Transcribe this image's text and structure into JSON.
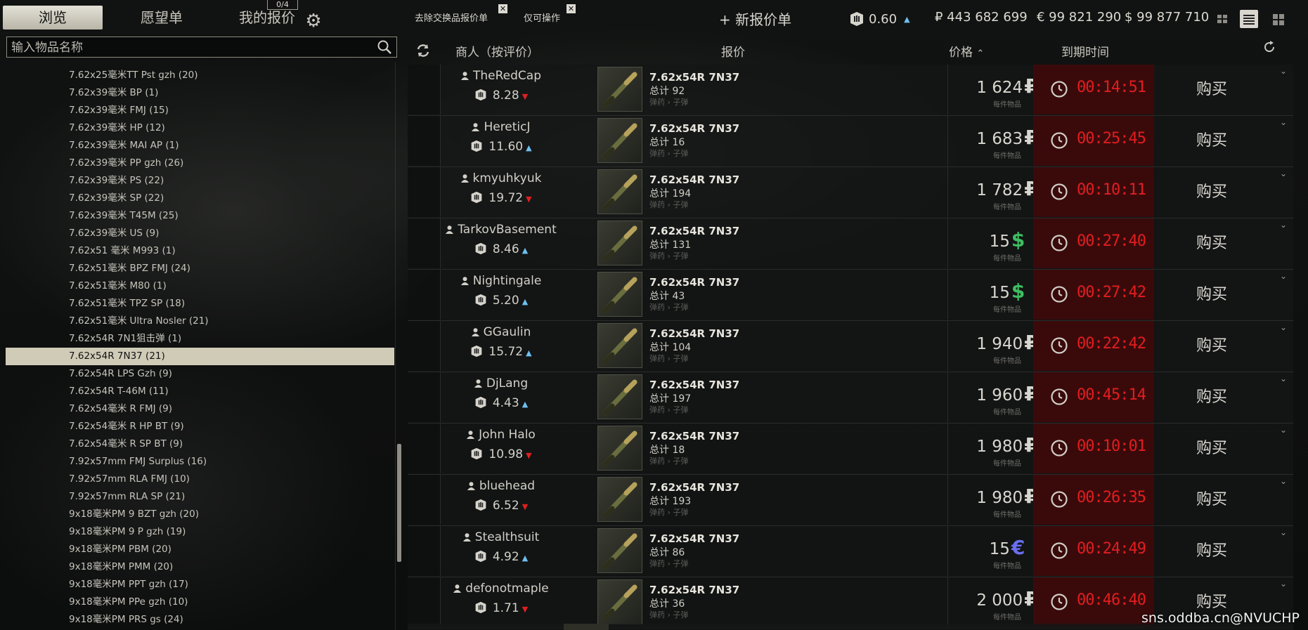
{
  "tabs": [
    {
      "label": "浏览"
    },
    {
      "label": "愿望单"
    },
    {
      "label": "我的报价"
    }
  ],
  "offers_badge": "0/4",
  "search": {
    "placeholder": "输入物品名称"
  },
  "categories": [
    "7.62x25毫米TT Pst gzh (20)",
    "7.62x39毫米 BP (1)",
    "7.62x39毫米 FMJ (15)",
    "7.62x39毫米 HP (12)",
    "7.62x39毫米 MAI AP (1)",
    "7.62x39毫米 PP gzh (26)",
    "7.62x39毫米 PS (22)",
    "7.62x39毫米 SP (22)",
    "7.62x39毫米 T45M (25)",
    "7.62x39毫米 US (9)",
    "7.62x51 毫米 M993 (1)",
    "7.62x51毫米 BPZ FMJ (24)",
    "7.62x51毫米 M80 (1)",
    "7.62x51毫米 TPZ SP (18)",
    "7.62x51毫米 Ultra Nosler (21)",
    "7.62x54R 7N1狙击弹 (1)",
    "7.62x54R 7N37 (21)",
    "7.62x54R LPS Gzh (9)",
    "7.62x54R T-46M (11)",
    "7.62x54毫米 R FMJ (9)",
    "7.62x54毫米 R HP BT (9)",
    "7.62x54毫米 R SP BT (9)",
    "7.92x57mm FMJ Surplus (16)",
    "7.92x57mm RLA FMJ (10)",
    "7.92x57mm RLA SP (21)",
    "9x18毫米PM 9 BZT gzh (20)",
    "9x18毫米PM 9 P gzh (19)",
    "9x18毫米PM PBM (20)",
    "9x18毫米PM PMM (20)",
    "9x18毫米PM PPT gzh (17)",
    "9x18毫米PM PPe gzh (10)",
    "9x18毫米PM PRS gs (24)"
  ],
  "selected_category_index": 16,
  "filters": {
    "remove_barter": "去除交换品报价单",
    "operable_only": "仅可操作"
  },
  "new_offer": "+ 新报价单",
  "player_rating": {
    "value": "0.60",
    "trend": "▲"
  },
  "currencies": {
    "rub": "₽ 443 682 699",
    "eur": "€ 99 821 290",
    "usd": "$ 99 877 710"
  },
  "columns": {
    "merchant": "商人（按评价）",
    "offer": "报价",
    "price": "价格",
    "price_sort": "⌃",
    "expiry": "到期时间"
  },
  "offers": [
    {
      "seller": "TheRedCap",
      "rating": "8.28",
      "trend": "down",
      "item": "7.62x54R 7N37",
      "qty": "总计 92",
      "category": "弹药 › 子弹",
      "price": "1 624",
      "currency": "₽",
      "per": "每件物品",
      "timer": "00:14:51",
      "buy": "购买"
    },
    {
      "seller": "HereticJ",
      "rating": "11.60",
      "trend": "up",
      "item": "7.62x54R 7N37",
      "qty": "总计 16",
      "category": "弹药 › 子弹",
      "price": "1 683",
      "currency": "₽",
      "per": "每件物品",
      "timer": "00:25:45",
      "buy": "购买"
    },
    {
      "seller": "kmyuhkyuk",
      "rating": "19.72",
      "trend": "down",
      "item": "7.62x54R 7N37",
      "qty": "总计 194",
      "category": "弹药 › 子弹",
      "price": "1 782",
      "currency": "₽",
      "per": "每件物品",
      "timer": "00:10:11",
      "buy": "购买"
    },
    {
      "seller": "TarkovBasement",
      "rating": "8.46",
      "trend": "up",
      "item": "7.62x54R 7N37",
      "qty": "总计 131",
      "category": "弹药 › 子弹",
      "price": "15",
      "currency": "$",
      "per": "每件物品",
      "timer": "00:27:40",
      "buy": "购买"
    },
    {
      "seller": "Nightingale",
      "rating": "5.20",
      "trend": "up",
      "item": "7.62x54R 7N37",
      "qty": "总计 43",
      "category": "弹药 › 子弹",
      "price": "15",
      "currency": "$",
      "per": "每件物品",
      "timer": "00:27:42",
      "buy": "购买"
    },
    {
      "seller": "GGaulin",
      "rating": "15.72",
      "trend": "up",
      "item": "7.62x54R 7N37",
      "qty": "总计 104",
      "category": "弹药 › 子弹",
      "price": "1 940",
      "currency": "₽",
      "per": "每件物品",
      "timer": "00:22:42",
      "buy": "购买"
    },
    {
      "seller": "DjLang",
      "rating": "4.43",
      "trend": "up",
      "item": "7.62x54R 7N37",
      "qty": "总计 197",
      "category": "弹药 › 子弹",
      "price": "1 960",
      "currency": "₽",
      "per": "每件物品",
      "timer": "00:45:14",
      "buy": "购买"
    },
    {
      "seller": "John Halo",
      "rating": "10.98",
      "trend": "down",
      "item": "7.62x54R 7N37",
      "qty": "总计 18",
      "category": "弹药 › 子弹",
      "price": "1 980",
      "currency": "₽",
      "per": "每件物品",
      "timer": "00:10:01",
      "buy": "购买"
    },
    {
      "seller": "bluehead",
      "rating": "6.52",
      "trend": "down",
      "item": "7.62x54R 7N37",
      "qty": "总计 193",
      "category": "弹药 › 子弹",
      "price": "1 980",
      "currency": "₽",
      "per": "每件物品",
      "timer": "00:26:35",
      "buy": "购买"
    },
    {
      "seller": "Stealthsuit",
      "rating": "4.92",
      "trend": "up",
      "item": "7.62x54R 7N37",
      "qty": "总计 86",
      "category": "弹药 › 子弹",
      "price": "15",
      "currency": "€",
      "per": "每件物品",
      "timer": "00:24:49",
      "buy": "购买"
    },
    {
      "seller": "defonotmaple",
      "rating": "1.71",
      "trend": "down",
      "item": "7.62x54R 7N37",
      "qty": "总计 36",
      "category": "弹药 › 子弹",
      "price": "2 000",
      "currency": "₽",
      "per": "每件物品",
      "timer": "00:46:40",
      "buy": "购买"
    }
  ],
  "colors": {
    "timer": "#e21d1f",
    "timer_bg": "#3a0a0b",
    "usd": "#3dbd62",
    "eur": "#6a6ff0",
    "up": "#6ec0f0",
    "down": "#e02020"
  },
  "watermark": "sns.oddba.cn@NVUCHP"
}
